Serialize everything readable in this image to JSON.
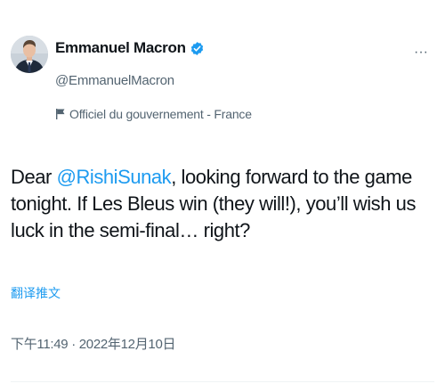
{
  "author": {
    "display_name": "Emmanuel Macron",
    "handle": "@EmmanuelMacron",
    "verified_icon": "verified-badge-icon",
    "affiliation_label": "Officiel du gouvernement - France",
    "affiliation_icon": "flag-icon",
    "avatar_icon": "avatar"
  },
  "menu": {
    "more_label": "···",
    "more_icon": "more-options-icon"
  },
  "tweet": {
    "text_before": "Dear ",
    "mention": "@RishiSunak",
    "text_after": ", looking forward to the game tonight. If Les Bleus win (they will!), you’ll wish us luck in the semi-final… right?"
  },
  "translate_label": "翻译推文",
  "timestamp": "下午11:49 · 2022年12月10日",
  "colors": {
    "accent": "#1d9bf0",
    "text": "#0f1419",
    "secondary": "#536471"
  }
}
